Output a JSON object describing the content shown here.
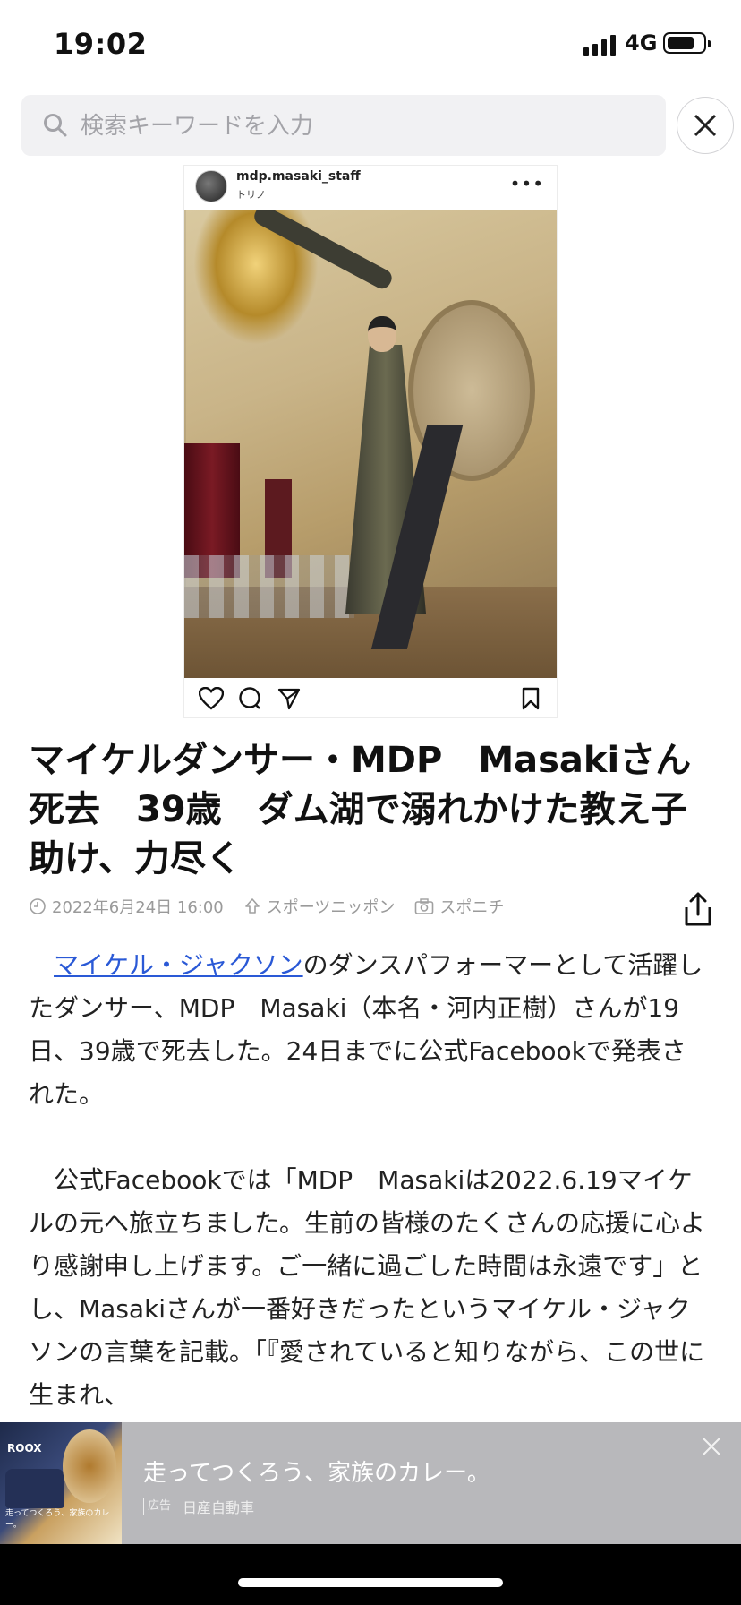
{
  "status_bar": {
    "time": "19:02",
    "network": "4G",
    "battery_level": 0.8
  },
  "search": {
    "placeholder": "検索キーワードを入力"
  },
  "embed": {
    "username": "mdp.masaki_staff",
    "location": "トリノ",
    "more_label": "•••"
  },
  "article": {
    "headline": "マイケルダンサー・MDP　Masakiさん死去　39歳　ダム湖で溺れかけた教え子助け、力尽く",
    "date": "2022年6月24日 16:00",
    "source": "スポーツニッポン",
    "photo_credit": "スポニチ",
    "link_text": "マイケル・ジャクソン",
    "para1_rest": "のダンスパフォーマーとして活躍したダンサー、MDP　Masaki（本名・河内正樹）さんが19日、39歳で死去した。24日までに公式Facebookで発表された。",
    "para2": "公式Facebookでは「MDP　Masakiは2022.6.19マイケルの元へ旅立ちました。生前の皆様のたくさんの応援に心より感謝申し上げます。ご一緒に過ごした時間は永遠です」とし、Masakiさんが一番好きだったというマイケル・ジャクソンの言葉を記載。「『愛されていると知りながら、この世に生まれ、"
  },
  "ad": {
    "title": "走ってつくろう、家族のカレー。",
    "tag": "広告",
    "advertiser": "日産自動車",
    "thumb_brand": "ROOX",
    "thumb_caption": "走ってつくろう、家族のカレー。"
  }
}
